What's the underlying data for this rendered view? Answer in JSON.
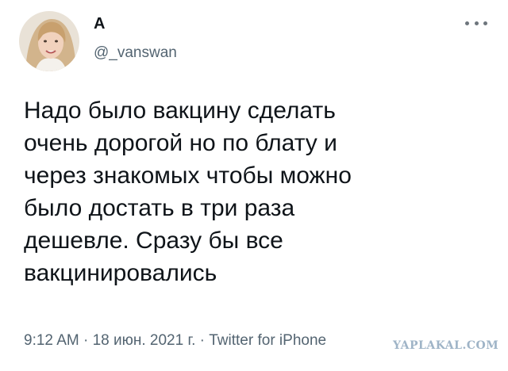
{
  "user": {
    "display_name": "A",
    "handle": "@_vanswan"
  },
  "tweet": {
    "text": "Надо было вакцину сделать\nочень дорогой но по блату и\nчерез знакомых чтобы можно\nбыло достать в три раза\nдешевле. Сразу бы все\nвакцинировались",
    "timestamp_line": "9:12 AM · 18 июн. 2021 г. · Twitter for iPhone"
  },
  "icons": {
    "more": "more-horizontal-icon"
  },
  "watermark": "YAPLAKAL.COM",
  "colors": {
    "text": "#0f1419",
    "secondary": "#536471",
    "background": "#ffffff"
  }
}
